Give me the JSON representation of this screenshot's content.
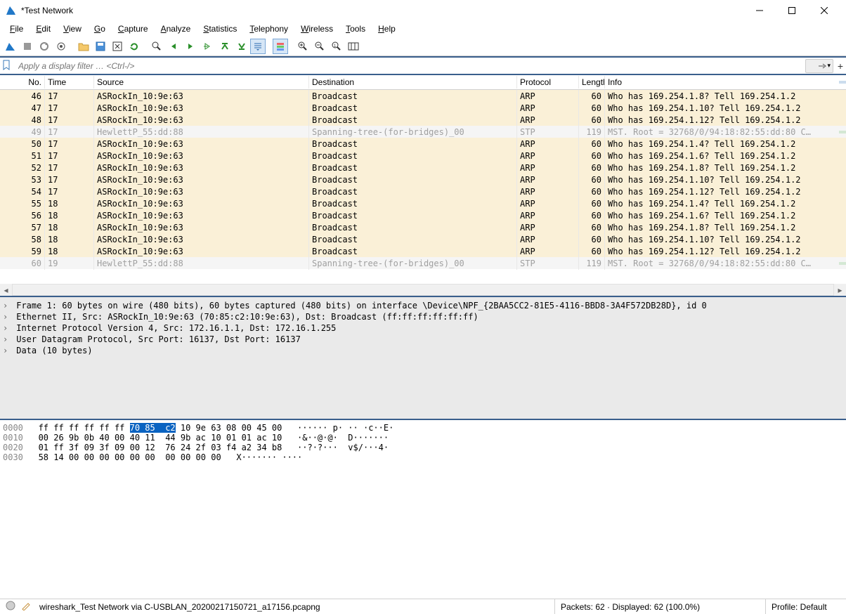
{
  "window": {
    "title": "*Test Network"
  },
  "menu": {
    "items": [
      "File",
      "Edit",
      "View",
      "Go",
      "Capture",
      "Analyze",
      "Statistics",
      "Telephony",
      "Wireless",
      "Tools",
      "Help"
    ]
  },
  "filter": {
    "placeholder": "Apply a display filter … <Ctrl-/>"
  },
  "columns": {
    "no": "No.",
    "time": "Time",
    "source": "Source",
    "destination": "Destination",
    "protocol": "Protocol",
    "length": "Length",
    "info": "Info"
  },
  "packets": [
    {
      "no": 46,
      "time": "17",
      "src": "ASRockIn_10:9e:63",
      "dst": "Broadcast",
      "proto": "ARP",
      "len": 60,
      "info": "Who has 169.254.1.8? Tell 169.254.1.2",
      "cls": "arp"
    },
    {
      "no": 47,
      "time": "17",
      "src": "ASRockIn_10:9e:63",
      "dst": "Broadcast",
      "proto": "ARP",
      "len": 60,
      "info": "Who has 169.254.1.10? Tell 169.254.1.2",
      "cls": "arp"
    },
    {
      "no": 48,
      "time": "17",
      "src": "ASRockIn_10:9e:63",
      "dst": "Broadcast",
      "proto": "ARP",
      "len": 60,
      "info": "Who has 169.254.1.12? Tell 169.254.1.2",
      "cls": "arp"
    },
    {
      "no": 49,
      "time": "17",
      "src": "HewlettP_55:dd:88",
      "dst": "Spanning-tree-(for-bridges)_00",
      "proto": "STP",
      "len": 119,
      "info": "MST. Root = 32768/0/94:18:82:55:dd:80  C…",
      "cls": "stp"
    },
    {
      "no": 50,
      "time": "17",
      "src": "ASRockIn_10:9e:63",
      "dst": "Broadcast",
      "proto": "ARP",
      "len": 60,
      "info": "Who has 169.254.1.4? Tell 169.254.1.2",
      "cls": "arp"
    },
    {
      "no": 51,
      "time": "17",
      "src": "ASRockIn_10:9e:63",
      "dst": "Broadcast",
      "proto": "ARP",
      "len": 60,
      "info": "Who has 169.254.1.6? Tell 169.254.1.2",
      "cls": "arp"
    },
    {
      "no": 52,
      "time": "17",
      "src": "ASRockIn_10:9e:63",
      "dst": "Broadcast",
      "proto": "ARP",
      "len": 60,
      "info": "Who has 169.254.1.8? Tell 169.254.1.2",
      "cls": "arp"
    },
    {
      "no": 53,
      "time": "17",
      "src": "ASRockIn_10:9e:63",
      "dst": "Broadcast",
      "proto": "ARP",
      "len": 60,
      "info": "Who has 169.254.1.10? Tell 169.254.1.2",
      "cls": "arp"
    },
    {
      "no": 54,
      "time": "17",
      "src": "ASRockIn_10:9e:63",
      "dst": "Broadcast",
      "proto": "ARP",
      "len": 60,
      "info": "Who has 169.254.1.12? Tell 169.254.1.2",
      "cls": "arp"
    },
    {
      "no": 55,
      "time": "18",
      "src": "ASRockIn_10:9e:63",
      "dst": "Broadcast",
      "proto": "ARP",
      "len": 60,
      "info": "Who has 169.254.1.4? Tell 169.254.1.2",
      "cls": "arp"
    },
    {
      "no": 56,
      "time": "18",
      "src": "ASRockIn_10:9e:63",
      "dst": "Broadcast",
      "proto": "ARP",
      "len": 60,
      "info": "Who has 169.254.1.6? Tell 169.254.1.2",
      "cls": "arp"
    },
    {
      "no": 57,
      "time": "18",
      "src": "ASRockIn_10:9e:63",
      "dst": "Broadcast",
      "proto": "ARP",
      "len": 60,
      "info": "Who has 169.254.1.8? Tell 169.254.1.2",
      "cls": "arp"
    },
    {
      "no": 58,
      "time": "18",
      "src": "ASRockIn_10:9e:63",
      "dst": "Broadcast",
      "proto": "ARP",
      "len": 60,
      "info": "Who has 169.254.1.10? Tell 169.254.1.2",
      "cls": "arp"
    },
    {
      "no": 59,
      "time": "18",
      "src": "ASRockIn_10:9e:63",
      "dst": "Broadcast",
      "proto": "ARP",
      "len": 60,
      "info": "Who has 169.254.1.12? Tell 169.254.1.2",
      "cls": "arp"
    },
    {
      "no": 60,
      "time": "19",
      "src": "HewlettP_55:dd:88",
      "dst": "Spanning-tree-(for-bridges)_00",
      "proto": "STP",
      "len": 119,
      "info": "MST. Root = 32768/0/94:18:82:55:dd:80  C…",
      "cls": "stp"
    }
  ],
  "details": {
    "lines": [
      "Frame 1: 60 bytes on wire (480 bits), 60 bytes captured (480 bits) on interface \\Device\\NPF_{2BAA5CC2-81E5-4116-BBD8-3A4F572DB28D}, id 0",
      "Ethernet II, Src: ASRockIn_10:9e:63 (70:85:c2:10:9e:63), Dst: Broadcast (ff:ff:ff:ff:ff:ff)",
      "Internet Protocol Version 4, Src: 172.16.1.1, Dst: 172.16.1.255",
      "User Datagram Protocol, Src Port: 16137, Dst Port: 16137",
      "Data (10 bytes)"
    ]
  },
  "hex": {
    "rows": [
      {
        "off": "0000",
        "b1": "ff ff ff ff ff ff ",
        "hl": "70 85  c2",
        "b2": " 10 9e 63 08 00 45 00",
        "asc": "   ······ p· ·· ·c··E·"
      },
      {
        "off": "0010",
        "b1": "00 26 9b 0b 40 00 40 11  44 9b ac 10 01 01 ac 10",
        "hl": "",
        "b2": "",
        "asc": "   ·&··@·@·  D·······"
      },
      {
        "off": "0020",
        "b1": "01 ff 3f 09 3f 09 00 12  76 24 2f 03 f4 a2 34 b8",
        "hl": "",
        "b2": "",
        "asc": "   ··?·?···  v$/···4·"
      },
      {
        "off": "0030",
        "b1": "58 14 00 00 00 00 00 00  00 00 00 00",
        "hl": "",
        "b2": "",
        "asc": "   X······· ····"
      }
    ]
  },
  "status": {
    "file": "wireshark_Test Network via C-USBLAN_20200217150721_a17156.pcapng",
    "packets": "Packets: 62 · Displayed: 62 (100.0%)",
    "profile": "Profile: Default"
  }
}
